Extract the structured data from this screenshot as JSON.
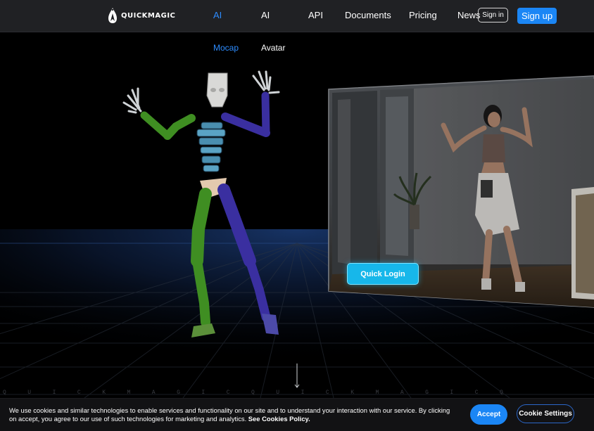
{
  "header": {
    "brand": "QUICKMAGIC",
    "nav": [
      {
        "label": "AI",
        "active": true
      },
      {
        "label": "AI",
        "active": false
      },
      {
        "label": "API",
        "active": false
      },
      {
        "label": "Documents",
        "active": false
      },
      {
        "label": "Pricing",
        "active": false
      },
      {
        "label": "News",
        "active": false
      }
    ],
    "sign_in": "Sign in",
    "sign_up": "Sign up"
  },
  "subnav": [
    {
      "label": "Mocap",
      "active": true
    },
    {
      "label": "Avatar",
      "active": false
    }
  ],
  "hero": {
    "quick_login": "Quick Login",
    "ticker": "QUICKMAGICQUICKMAGICQ"
  },
  "cookie": {
    "text": "We use cookies and similar technologies to enable services and functionality on our site and to understand your interaction with our service. By clicking on accept, you agree to our use of such technologies for marketing and analytics.",
    "link": "See Cookies Policy.",
    "accept": "Accept",
    "settings": "Cookie Settings"
  },
  "colors": {
    "accent": "#1b86f5",
    "active_nav": "#2d8cff",
    "header_bg": "#202124",
    "quick_login": "#17b7ea",
    "skeleton_left_leg": "#3f8e22",
    "skeleton_right_leg": "#3a2fa0",
    "skeleton_spine": "#4a8fb0"
  },
  "icons": {
    "logo": "quickmagic-logo-icon",
    "scroll": "scroll-down-arrow-icon"
  }
}
